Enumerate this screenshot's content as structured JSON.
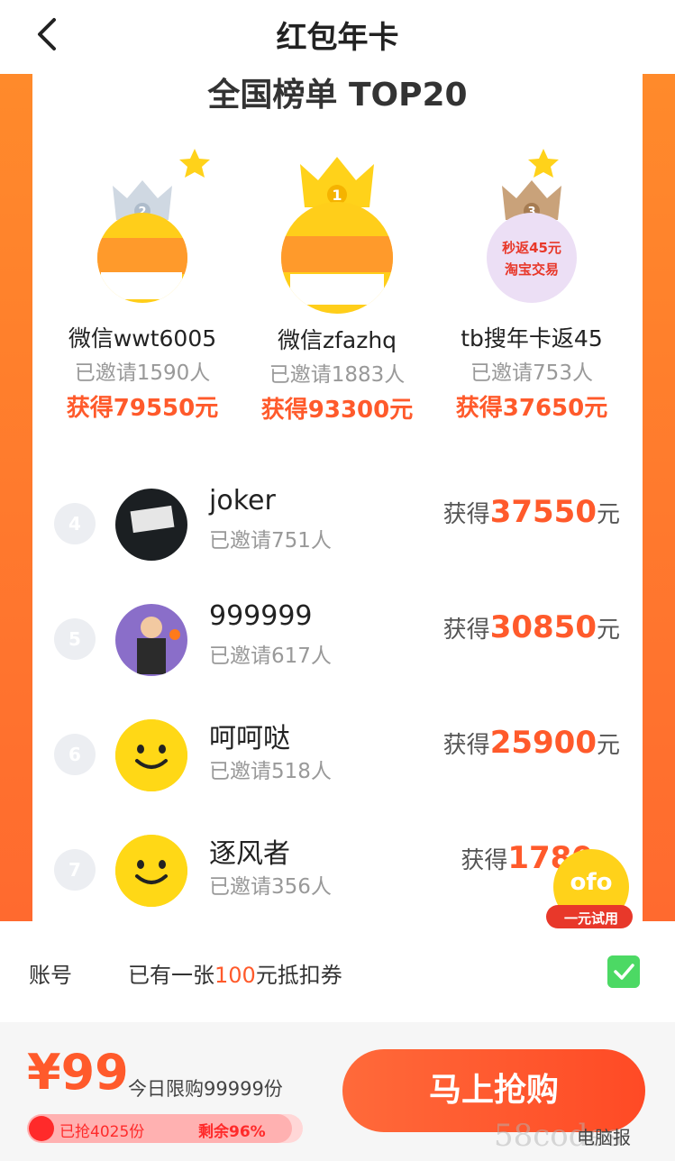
{
  "header": {
    "title": "红包年卡"
  },
  "ranking": {
    "title": "全国榜单 TOP20",
    "top3": [
      {
        "rank": "2",
        "name": "微信wwt6005",
        "invited": "已邀请1590人",
        "earned": "获得79550元"
      },
      {
        "rank": "1",
        "name": "微信zfazhq",
        "invited": "已邀请1883人",
        "earned": "获得93300元"
      },
      {
        "rank": "3",
        "name": "tb搜年卡返45",
        "invited": "已邀请753人",
        "earned": "获得37650元",
        "badge_text_1": "秒返45元",
        "badge_text_2": "淘宝交易"
      }
    ],
    "list": [
      {
        "rank": "4",
        "name": "joker",
        "invited": "已邀请751人",
        "earn_prefix": "获得",
        "amount": "37550",
        "unit": "元"
      },
      {
        "rank": "5",
        "name": "999999",
        "invited": "已邀请617人",
        "earn_prefix": "获得",
        "amount": "30850",
        "unit": "元"
      },
      {
        "rank": "6",
        "name": "呵呵哒",
        "invited": "已邀请518人",
        "earn_prefix": "获得",
        "amount": "25900",
        "unit": "元"
      },
      {
        "rank": "7",
        "name": "逐风者",
        "invited": "已邀请356人",
        "earn_prefix": "获得",
        "amount": "1780",
        "unit": ""
      }
    ]
  },
  "float_ad": {
    "brand": "ofo",
    "tag": "一元试用"
  },
  "account": {
    "label": "账号",
    "coupon_prefix": "已有一张",
    "coupon_amount": "100",
    "coupon_suffix": "元抵扣券"
  },
  "purchase": {
    "price": "¥99",
    "limit": "今日限购99999份",
    "sold": "已抢4025份",
    "remaining": "剩余96%",
    "remaining_fraction": 0.96,
    "buy_label": "马上抢购"
  },
  "watermark": {
    "text": "58codes",
    "account": "电脑报"
  },
  "colors": {
    "accent": "#ff5a2b",
    "background": "#ff7a2f",
    "check": "#4cd964"
  }
}
